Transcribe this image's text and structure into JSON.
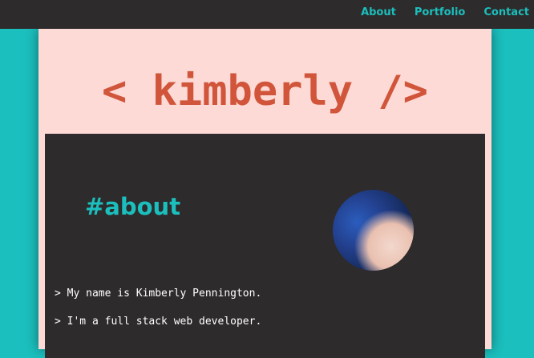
{
  "nav": {
    "links": [
      "About",
      "Portfolio",
      "Contact"
    ]
  },
  "header": {
    "brand": "< kimberly />"
  },
  "about": {
    "heading": "#about",
    "lines": [
      "> My name is Kimberly Pennington.",
      "> I'm a full stack web developer."
    ]
  },
  "colors": {
    "accent": "#1bbfbd",
    "brand": "#d1553a",
    "card": "#fddad6",
    "dark": "#2e2b2c"
  },
  "icons": {
    "avatar": "profile-photo"
  }
}
